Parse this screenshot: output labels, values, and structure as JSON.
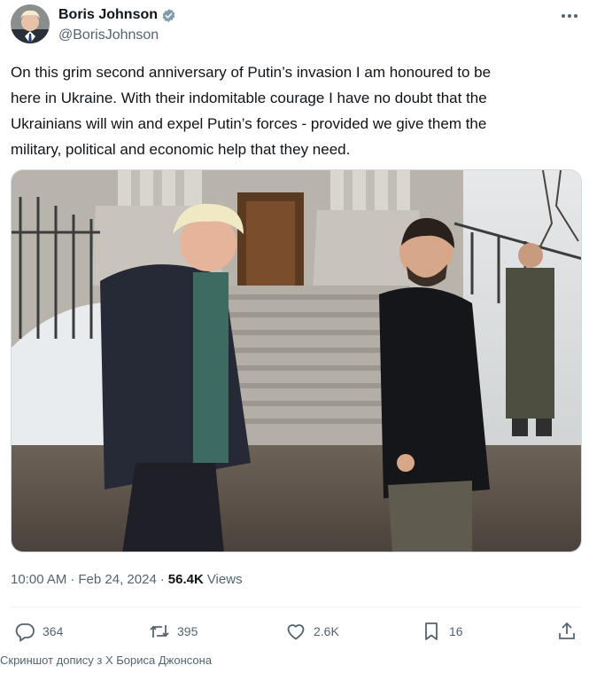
{
  "author": {
    "name": "Boris Johnson",
    "handle": "@BorisJohnson",
    "verified": true
  },
  "tweet": {
    "lines": [
      "On this grim second anniversary of Putin’s invasion I am honoured to be",
      "here in Ukraine. With their indomitable courage I have no doubt that the",
      "Ukrainians will win and expel Putin’s forces - provided we give them the",
      "military, political and economic help that they need."
    ]
  },
  "meta": {
    "time": "10:00 AM",
    "separator": "·",
    "date": "Feb 24, 2024",
    "views_count": "56.4K",
    "views_label": "Views"
  },
  "actions": {
    "replies": "364",
    "reposts": "395",
    "likes": "2.6K",
    "bookmarks": "16"
  },
  "caption": "Скриншот допису з X Бориса Джонсона",
  "colors": {
    "text_primary": "#0f1419",
    "text_secondary": "#536471",
    "verified_badge": "#829aab",
    "border": "#eff3f4"
  },
  "icons": {
    "verified": "verified-badge-icon",
    "more": "more-dots-icon",
    "reply": "reply-bubble-icon",
    "repost": "repost-arrows-icon",
    "like": "heart-icon",
    "bookmark": "bookmark-icon",
    "share": "share-upload-icon"
  }
}
